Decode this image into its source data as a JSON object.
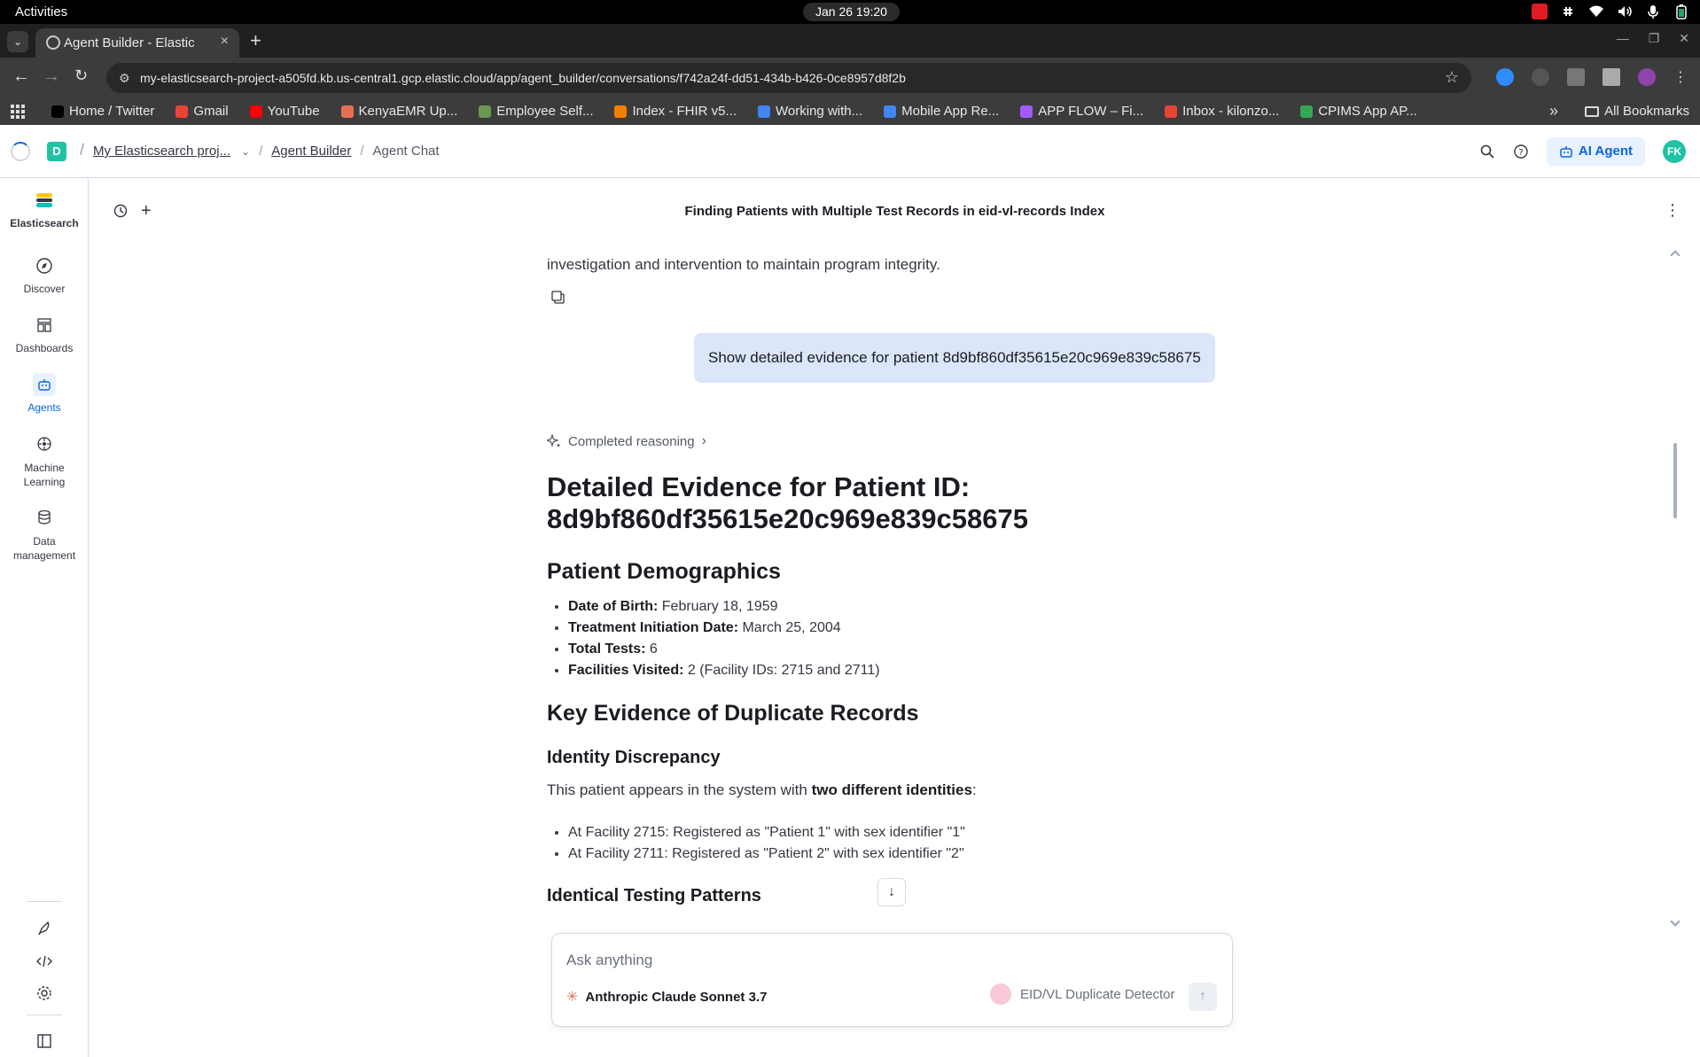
{
  "os": {
    "activities": "Activities",
    "clock": "Jan 26  19:20"
  },
  "browser": {
    "tab_title": "Agent Builder - Elastic",
    "url": "my-elasticsearch-project-a505fd.kb.us-central1.gcp.elastic.cloud/app/agent_builder/conversations/f742a24f-dd51-434b-b426-0ce8957d8f2b",
    "bookmarks": [
      {
        "label": "Home / Twitter",
        "color": "#000000"
      },
      {
        "label": "Gmail",
        "color": "#ea4335"
      },
      {
        "label": "YouTube",
        "color": "#ff0000"
      },
      {
        "label": "KenyaEMR Up...",
        "color": "#e76f51"
      },
      {
        "label": "Employee Self...",
        "color": "#6a994e"
      },
      {
        "label": "Index - FHIR v5...",
        "color": "#f77f00"
      },
      {
        "label": "Working with...",
        "color": "#4285f4"
      },
      {
        "label": "Mobile App Re...",
        "color": "#4285f4"
      },
      {
        "label": "APP FLOW – Fi...",
        "color": "#a259ff"
      },
      {
        "label": "Inbox - kilonzo...",
        "color": "#ea4335"
      },
      {
        "label": "CPIMS App AP...",
        "color": "#34a853"
      }
    ],
    "all_bookmarks": "All Bookmarks"
  },
  "kibana": {
    "space_letter": "D",
    "breadcrumbs": [
      "My Elasticsearch proj...",
      "Agent Builder",
      "Agent Chat"
    ],
    "ai_agent_label": "AI Agent",
    "avatar_initials": "FK",
    "accent": "#0b64dd"
  },
  "nav": {
    "brand": "Elasticsearch",
    "items": [
      {
        "label": "Discover",
        "icon": "compass-icon"
      },
      {
        "label": "Dashboards",
        "icon": "dashboard-icon"
      },
      {
        "label": "Agents",
        "icon": "robot-icon",
        "active": true
      },
      {
        "label": "Machine Learning",
        "icon": "ml-icon"
      },
      {
        "label": "Data management",
        "icon": "database-icon"
      }
    ]
  },
  "conversation": {
    "title": "Finding Patients with Multiple Test Records in eid-vl-records Index",
    "prev_text": "investigation and intervention to maintain program integrity.",
    "user_message": "Show detailed evidence for patient 8d9bf860df35615e20c969e839c58675",
    "reasoning_label": "Completed reasoning",
    "heading": "Detailed Evidence for Patient ID: 8d9bf860df35615e20c969e839c58675",
    "demographics_heading": "Patient Demographics",
    "demographics": [
      {
        "label": "Date of Birth:",
        "value": " February 18, 1959"
      },
      {
        "label": "Treatment Initiation Date:",
        "value": " March 25, 2004"
      },
      {
        "label": "Total Tests:",
        "value": " 6"
      },
      {
        "label": "Facilities Visited:",
        "value": " 2 (Facility IDs: 2715 and 2711)"
      }
    ],
    "evidence_heading": "Key Evidence of Duplicate Records",
    "identity_heading": "Identity Discrepancy",
    "identity_intro": "This patient appears in the system with ",
    "identity_bold": "two different identities",
    "identity_colon": ":",
    "identity_items": [
      "At Facility 2715: Registered as \"Patient 1\" with sex identifier \"1\"",
      "At Facility 2711: Registered as \"Patient 2\" with sex identifier \"2\""
    ],
    "patterns_heading": "Identical Testing Patterns"
  },
  "composer": {
    "placeholder": "Ask anything",
    "model": "Anthropic Claude Sonnet 3.7",
    "agent": "EID/VL Duplicate Detector"
  }
}
